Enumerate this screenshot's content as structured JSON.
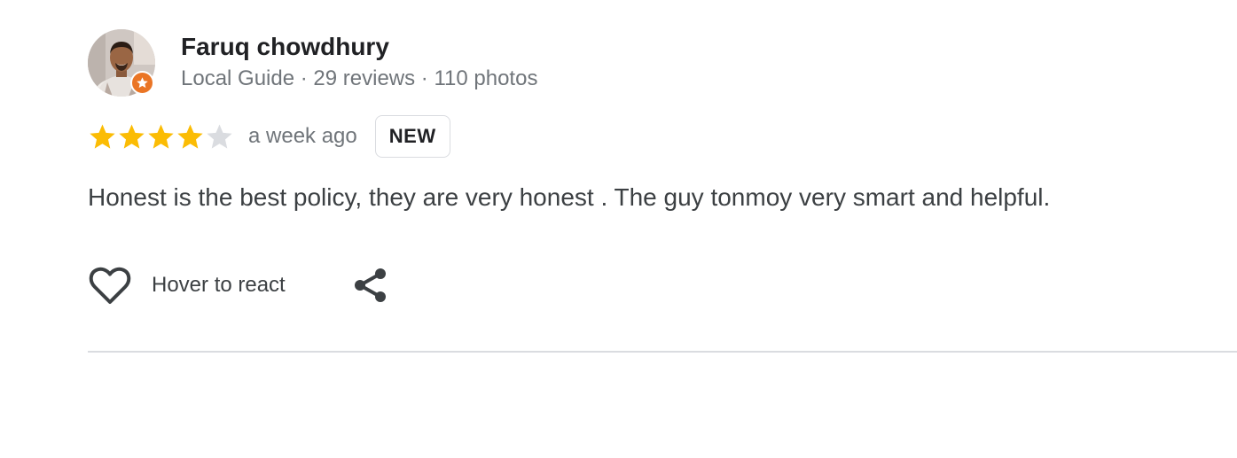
{
  "reviewer": {
    "name": "Faruq chowdhury",
    "meta": "Local Guide · 29 reviews · 110 photos",
    "badge_icon": "local-guide-star-icon",
    "badge_color": "#ea7525"
  },
  "review": {
    "rating": 4,
    "rating_max": 5,
    "time": "a week ago",
    "new_label": "NEW",
    "text": "Honest is the best policy, they are very honest . The guy tonmoy very smart and helpful."
  },
  "actions": {
    "react_label": "Hover to react",
    "react_icon": "heart-icon",
    "share_icon": "share-icon"
  },
  "colors": {
    "star_filled": "#fbbc04",
    "star_empty": "#dadce0",
    "text_secondary": "#70757a",
    "divider": "#dadce0"
  }
}
